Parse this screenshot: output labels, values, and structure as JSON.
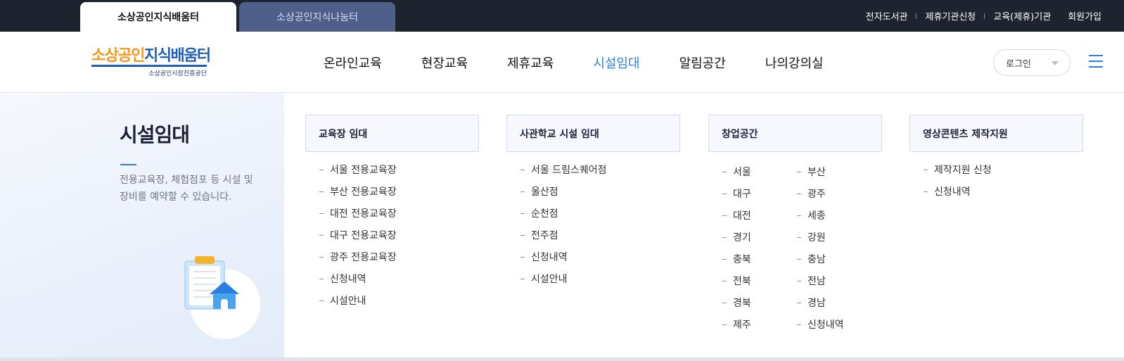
{
  "site_tabs": [
    {
      "label": "소상공인지식배움터",
      "active": true
    },
    {
      "label": "소상공인지식나눔터",
      "active": false
    }
  ],
  "utility_nav": [
    "전자도서관",
    "제휴기관신청",
    "교육(제휴)기관",
    "회원가입"
  ],
  "logo": {
    "part1": "소상공인",
    "part2": "지식배움터",
    "sub": "소상공인시장진흥공단"
  },
  "gnb": {
    "items": [
      "온라인교육",
      "현장교육",
      "제휴교육",
      "시설임대",
      "알림공간",
      "나의강의실"
    ],
    "active": "시설임대"
  },
  "login": {
    "label": "로그인"
  },
  "colors": {
    "accent": "#2a7de1",
    "topbar": "#1e2330",
    "logo_orange": "#f39a1d",
    "logo_blue": "#1d5fb8"
  },
  "mega_menu": {
    "title": "시설임대",
    "description": "전용교육장, 체험점포 등 시설 및 장비를 예약할 수 있습니다.",
    "columns": [
      {
        "heading": "교육장 임대",
        "items": [
          "서울 전용교육장",
          "부산 전용교육장",
          "대전 전용교육장",
          "대구 전용교육장",
          "광주 전용교육장",
          "신청내역",
          "시설안내"
        ]
      },
      {
        "heading": "사관학교 시설 임대",
        "items": [
          "서울 드림스퀘어점",
          "울산점",
          "순천점",
          "전주점",
          "신청내역",
          "시설안내"
        ]
      },
      {
        "heading": "창업공간",
        "items": [
          "서울",
          "부산",
          "대구",
          "광주",
          "대전",
          "세종",
          "경기",
          "강원",
          "충북",
          "충남",
          "전북",
          "전남",
          "경북",
          "경남",
          "제주",
          "신청내역"
        ]
      },
      {
        "heading": "영상콘텐츠 제작지원",
        "items": [
          "제작지원 신청",
          "신청내역"
        ]
      }
    ]
  },
  "icons": [
    "caret-down-icon",
    "hamburger-menu-icon",
    "facility-rental-illustration"
  ]
}
